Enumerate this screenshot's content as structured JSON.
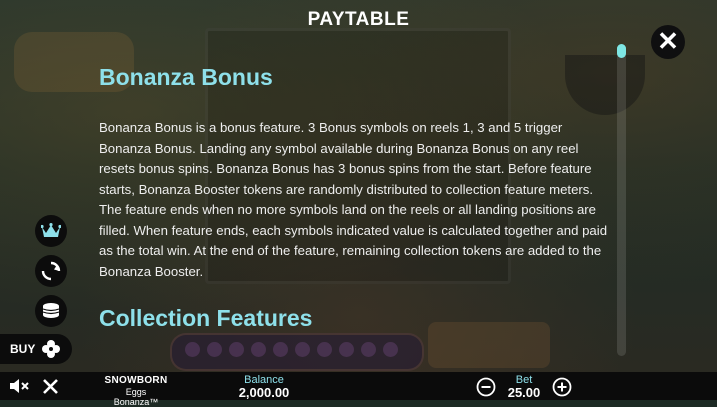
{
  "header": {
    "title": "PAYTABLE"
  },
  "sections": [
    {
      "heading": "Bonanza Bonus",
      "text": "Bonanza Bonus is a bonus feature. 3 Bonus symbols on reels 1, 3 and 5 trigger Bonanza Bonus. Landing any symbol available during Bonanza Bonus on any reel resets bonus spins. Bonanza Bonus has 3 bonus spins from the start. Before feature starts, Bonanza Booster tokens are randomly distributed to collection feature meters. The feature ends when no more symbols land on the reels or all landing positions are filled. When feature ends, each symbols indicated value is calculated together and paid as the total win. At the end of the feature, remaining collection tokens are added to the Bonanza Booster."
    },
    {
      "heading": "Collection Features"
    }
  ],
  "side_menu": {
    "buy_label": "BUY"
  },
  "footer": {
    "game_provider": "SNOWBORN",
    "game_name": "Eggs Bonanza™",
    "balance_label": "Balance",
    "balance_value": "2,000.00",
    "bet_label": "Bet",
    "bet_value": "25.00"
  },
  "scroll": {
    "position": 0.0
  },
  "colors": {
    "accent": "#8ee0ea",
    "scroll_thumb": "#7ee7e4",
    "panel": "#0c0c0c"
  },
  "icons": [
    "close-icon",
    "crown-icon",
    "autoplay-icon",
    "coins-icon",
    "buy-icon",
    "sound-off-icon",
    "exit-icon",
    "minus-icon",
    "plus-icon"
  ]
}
